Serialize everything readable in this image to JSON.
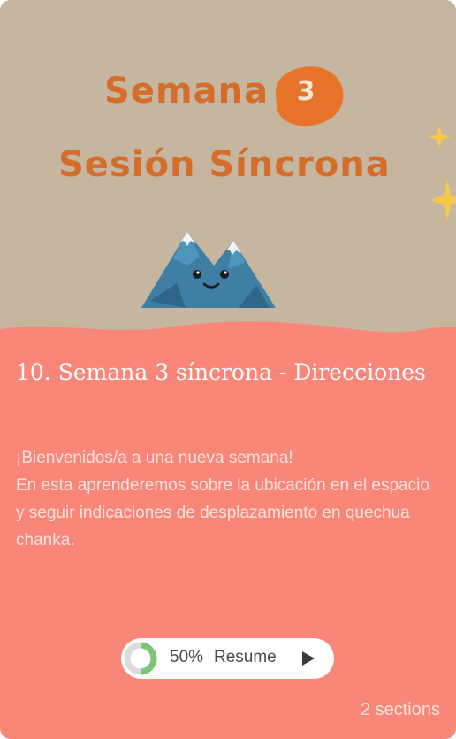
{
  "banner": {
    "week_word": "Semana",
    "week_number": "3",
    "session_word": "Sesión Síncrona",
    "mascot_icon": "smiling-mountain-icon",
    "star_icon": "star-icon",
    "colors": {
      "background": "#c6b59f",
      "title": "#d46d2a",
      "badge": "#e8742a"
    }
  },
  "course": {
    "title": "10. Semana 3 síncrona - Direcciones",
    "description_lines": [
      "¡Bienvenidos/a a una nueva semana!",
      "En esta aprenderemos sobre la ubicación en el espacio y seguir indicaciones de desplazamiento en quechua chanka."
    ]
  },
  "resume": {
    "progress_percent": 50,
    "progress_label": "50%",
    "label": "Resume",
    "icon": "play-icon"
  },
  "sections_label": "2 sections",
  "colors": {
    "card": "#f8877a",
    "progress": "#7cc576",
    "pill": "#ffffff"
  }
}
